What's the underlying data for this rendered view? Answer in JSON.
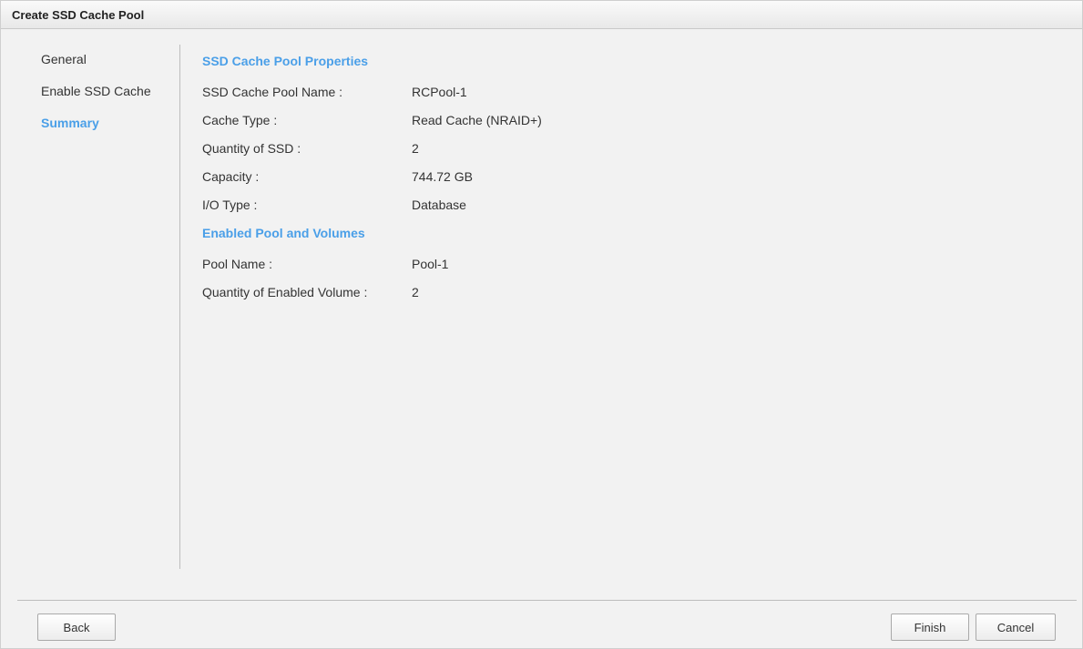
{
  "window": {
    "title": "Create SSD Cache Pool"
  },
  "steps": [
    {
      "label": "General",
      "active": false
    },
    {
      "label": "Enable SSD Cache",
      "active": false
    },
    {
      "label": "Summary",
      "active": true
    }
  ],
  "properties": {
    "title": "SSD Cache Pool Properties",
    "rows": [
      {
        "label": "SSD Cache Pool Name :",
        "value": "RCPool-1"
      },
      {
        "label": "Cache Type :",
        "value": "Read Cache (NRAID+)"
      },
      {
        "label": "Quantity of SSD :",
        "value": "2"
      },
      {
        "label": "Capacity :",
        "value": "744.72 GB"
      },
      {
        "label": "I/O Type :",
        "value": "Database"
      }
    ]
  },
  "enabled": {
    "title": "Enabled Pool and Volumes",
    "rows": [
      {
        "label": "Pool Name :",
        "value": "Pool-1"
      },
      {
        "label": "Quantity of Enabled Volume :",
        "value": "2"
      }
    ]
  },
  "buttons": {
    "back": "Back",
    "finish": "Finish",
    "cancel": "Cancel"
  },
  "colors": {
    "accent": "#4a9fe8",
    "background": "#f2f2f2"
  }
}
